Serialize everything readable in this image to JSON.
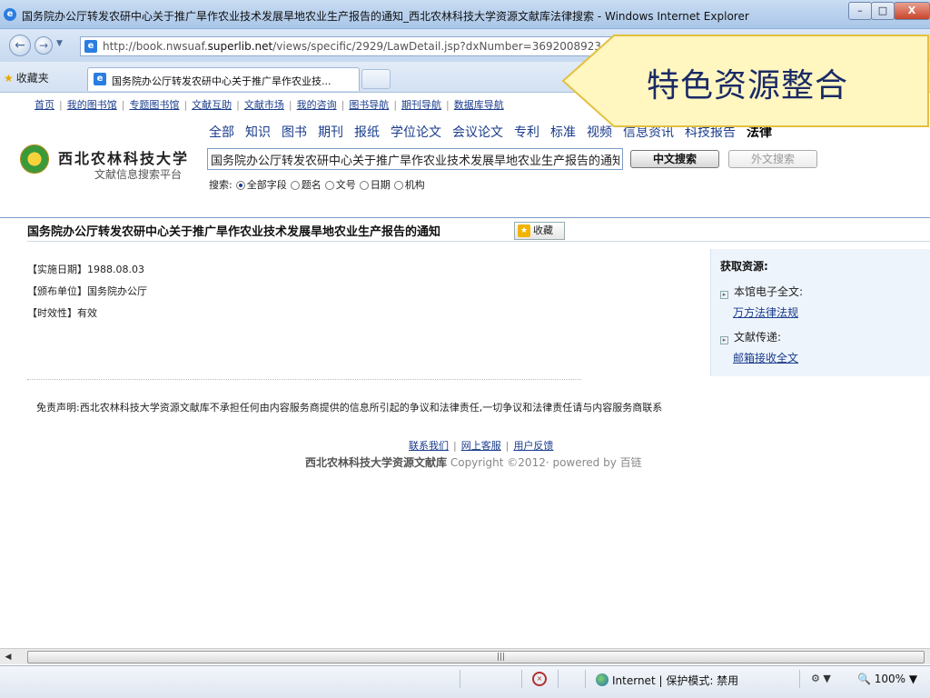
{
  "window": {
    "title": "国务院办公厅转发农研中心关于推广旱作农业技术发展旱地农业生产报告的通知_西北农林科技大学资源文献库法律搜索 - Windows Internet Explorer",
    "close_glyph": "X"
  },
  "address_bar": {
    "url_prefix": "http://book.nwsuaf.",
    "url_domain": "superlib.net",
    "url_suffix": "/views/specific/2929/LawDetail.jsp?dxNumber=3692008923"
  },
  "tabs": {
    "favorites_label": "收藏夹",
    "active_tab": "国务院办公厅转发农研中心关于推广旱作农业技..."
  },
  "callout": {
    "text": "特色资源整合"
  },
  "site": {
    "top_nav": [
      "首页",
      "我的图书馆",
      "专题图书馆",
      "文献互助",
      "文献市场",
      "我的咨询",
      "图书导航",
      "期刊导航",
      "数据库导航"
    ],
    "logo_name": "西北农林科技大学",
    "logo_sub": "文献信息搜索平台",
    "categories": [
      "全部",
      "知识",
      "图书",
      "期刊",
      "报纸",
      "学位论文",
      "会议论文",
      "专利",
      "标准",
      "视频",
      "信息资讯",
      "科技报告",
      "法律"
    ],
    "active_category": "法律",
    "search_value": "国务院办公厅转发农研中心关于推广旱作农业技术发展旱地农业生产报告的通知",
    "search_button_cn": "中文搜索",
    "search_button_en": "外文搜索",
    "scope_label": "搜索:",
    "scope_options": [
      "全部字段",
      "题名",
      "文号",
      "日期",
      "机构"
    ],
    "scope_selected": "全部字段"
  },
  "document": {
    "title": "国务院办公厅转发农研中心关于推广旱作农业技术发展旱地农业生产报告的通知",
    "favorite_button": "收藏",
    "fields": [
      {
        "label": "【实施日期】",
        "value": "1988.08.03"
      },
      {
        "label": "【颁布单位】",
        "value": "国务院办公厅"
      },
      {
        "label": "【时效性】",
        "value": "有效"
      }
    ]
  },
  "resources": {
    "heading": "获取资源:",
    "items": [
      {
        "label": "本馆电子全文:",
        "link": "万方法律法规"
      },
      {
        "label": "文献传递:",
        "link": "邮箱接收全文"
      }
    ]
  },
  "footer": {
    "disclaimer": "免责声明:西北农林科技大学资源文献库不承担任何由内容服务商提供的信息所引起的争议和法律责任,一切争议和法律责任请与内容服务商联系",
    "links": [
      "联系我们",
      "网上客服",
      "用户反馈"
    ],
    "copyright_org": "西北农林科技大学资源文献库",
    "copyright_text": "Copyright ©2012· powered by 百链"
  },
  "statusbar": {
    "zone": "Internet | 保护模式: 禁用",
    "zoom": "100%"
  },
  "colors": {
    "link": "#1a3c8c",
    "callout_fill": "#fff6c0",
    "callout_border": "#e3c040",
    "callout_text": "#1a2a66"
  }
}
